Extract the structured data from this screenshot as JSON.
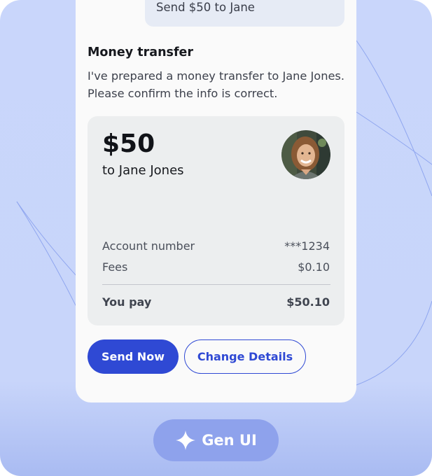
{
  "chat": {
    "user_message": "Send $50 to Jane"
  },
  "assistant": {
    "title": "Money transfer",
    "body": "I've prepared a money transfer to Jane Jones. Please confirm the info is correct."
  },
  "transfer": {
    "amount": "$50",
    "recipient": "to Jane Jones",
    "avatar_icon": "recipient-avatar",
    "rows": [
      {
        "label": "Account number",
        "value": "***1234"
      },
      {
        "label": "Fees",
        "value": "$0.10"
      }
    ],
    "total": {
      "label": "You pay",
      "value": "$50.10"
    }
  },
  "actions": {
    "primary_label": "Send Now",
    "secondary_label": "Change Details"
  },
  "footer": {
    "genui_label": "Gen UI",
    "genui_icon": "sparkle-icon"
  },
  "colors": {
    "accent": "#2f49d4",
    "background": "#c9d6fb",
    "card": "#fafafa",
    "pill": "#8ea2ec"
  }
}
